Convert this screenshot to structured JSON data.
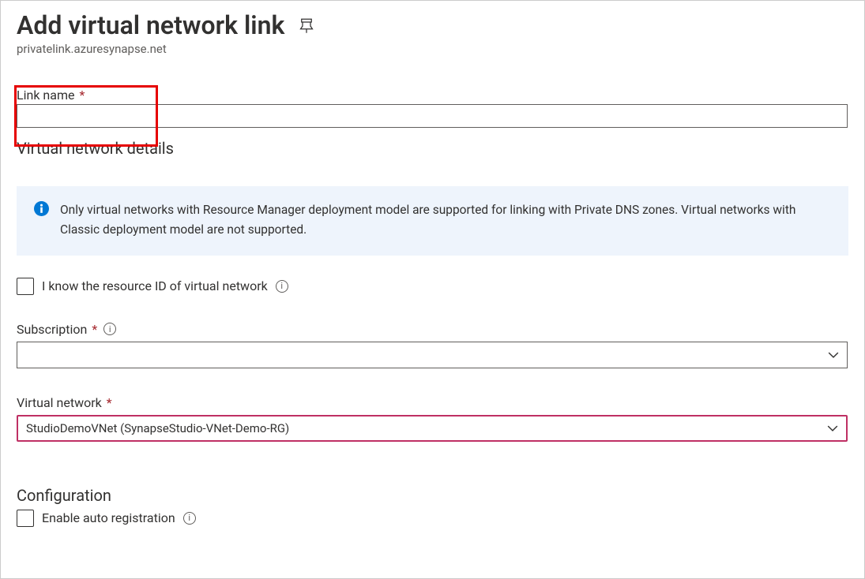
{
  "header": {
    "title": "Add virtual network link",
    "subtitle": "privatelink.azuresynapse.net"
  },
  "form": {
    "link_name_label": "Link name",
    "link_name_value": "",
    "vnet_details_header": "Virtual network details",
    "info_text": "Only virtual networks with Resource Manager deployment model are supported for linking with Private DNS zones. Virtual networks with Classic deployment model are not supported.",
    "know_resource_id_label": "I know the resource ID of virtual network",
    "subscription_label": "Subscription",
    "subscription_value": "",
    "virtual_network_label": "Virtual network",
    "virtual_network_value": "StudioDemoVNet (SynapseStudio-VNet-Demo-RG)",
    "configuration_header": "Configuration",
    "enable_auto_reg_label": "Enable auto registration"
  }
}
